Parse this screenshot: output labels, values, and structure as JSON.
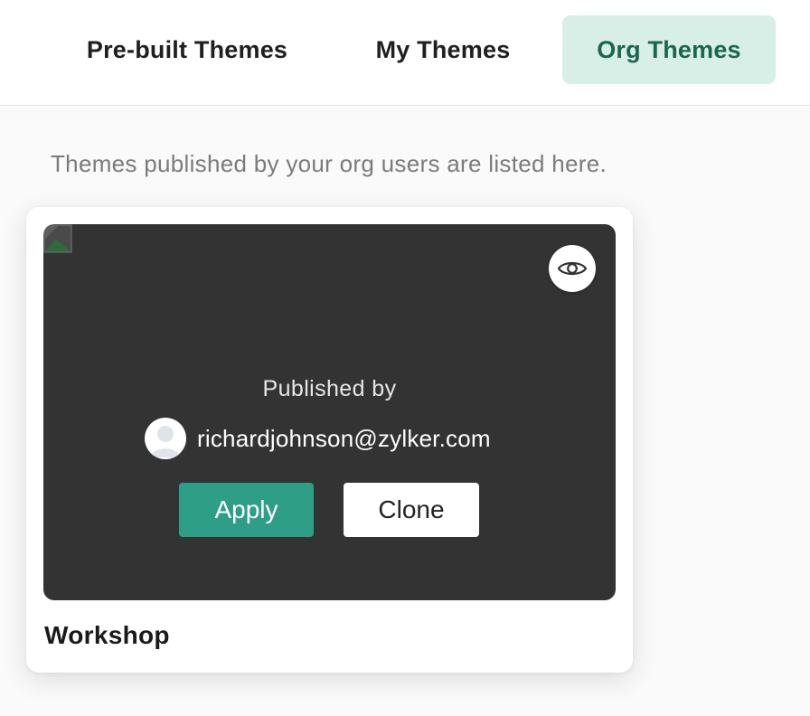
{
  "tabs": [
    {
      "label": "Pre-built Themes",
      "active": false
    },
    {
      "label": "My Themes",
      "active": false
    },
    {
      "label": "Org Themes",
      "active": true
    }
  ],
  "subtitle": "Themes published by your org users are listed here.",
  "theme_card": {
    "name": "Workshop",
    "published_by_label": "Published by",
    "publisher_email": "richardjohnson@zylker.com",
    "apply_label": "Apply",
    "clone_label": "Clone",
    "preview_icon": "eye-icon",
    "avatar_icon": "user-avatar-icon",
    "broken_image_icon": "broken-image-icon"
  },
  "colors": {
    "active_tab_bg": "#d7efe7",
    "active_tab_text": "#1c6650",
    "apply_button": "#2e9e86",
    "preview_bg": "#333333"
  }
}
